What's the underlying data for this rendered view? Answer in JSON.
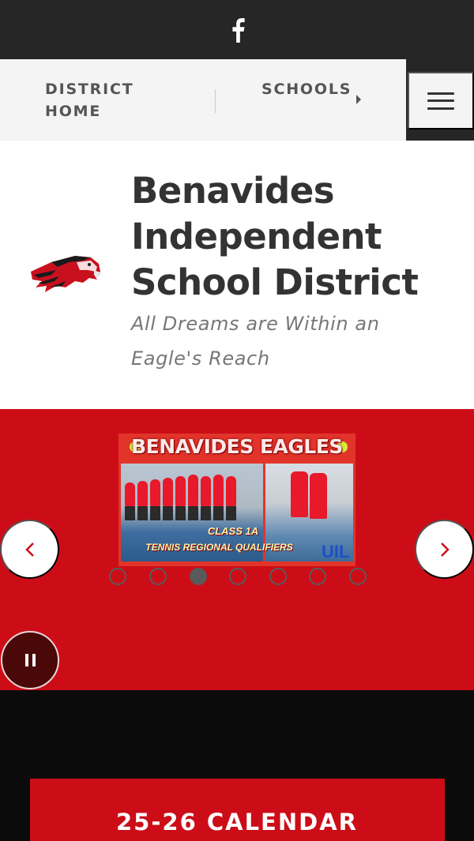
{
  "social": {
    "facebook_icon": "facebook-icon"
  },
  "nav": {
    "district_home": "DISTRICT HOME",
    "schools": "SCHOOLS",
    "menu_icon": "hamburger-menu-icon"
  },
  "header": {
    "logo": "eagle-logo",
    "title": "Benavides Independent School District",
    "tagline": "All Dreams are Within an Eagle's Reach"
  },
  "slider": {
    "image_banner_text": "BENAVIDES EAGLES",
    "image_class_text": "CLASS 1A",
    "image_sub_text": "TENNIS REGIONAL QUALIFIERS",
    "image_logo_text": "UIL",
    "total_slides": 7,
    "active_slide": 3,
    "prev_icon": "chevron-left-icon",
    "next_icon": "chevron-right-icon",
    "pause_icon": "pause-icon"
  },
  "colors": {
    "brand_red": "#cc0d17",
    "topbar": "#262626",
    "nav_bg": "#f4f4f4",
    "text_dark": "#333333",
    "tagline": "#777777"
  },
  "calendar": {
    "label": "25-26 CALENDAR"
  }
}
